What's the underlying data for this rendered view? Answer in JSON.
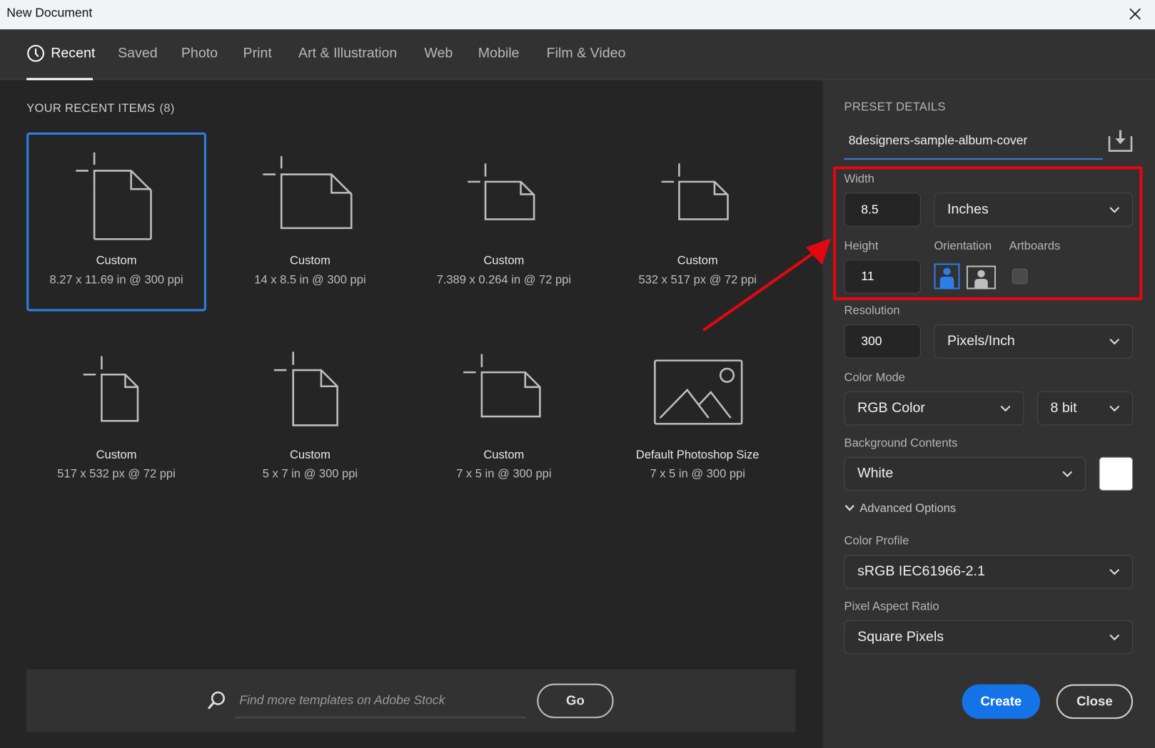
{
  "window": {
    "title": "New Document"
  },
  "tabs": [
    {
      "label": "Recent",
      "active": true
    },
    {
      "label": "Saved"
    },
    {
      "label": "Photo"
    },
    {
      "label": "Print"
    },
    {
      "label": "Art & Illustration"
    },
    {
      "label": "Web"
    },
    {
      "label": "Mobile"
    },
    {
      "label": "Film & Video"
    }
  ],
  "recent": {
    "title": "YOUR RECENT ITEMS",
    "count": "(8)",
    "items": [
      {
        "name": "Custom",
        "spec": "8.27 x 11.69 in @ 300 ppi",
        "icon": "portrait-doc-icon",
        "selected": true
      },
      {
        "name": "Custom",
        "spec": "14 x 8.5 in @ 300 ppi",
        "icon": "landscape-doc-icon"
      },
      {
        "name": "Custom",
        "spec": "7.389 x 0.264 in @ 72 ppi",
        "icon": "landscape-doc-icon"
      },
      {
        "name": "Custom",
        "spec": "532 x 517 px @ 72 ppi",
        "icon": "landscape-doc-icon"
      },
      {
        "name": "Custom",
        "spec": "517 x 532 px @ 72 ppi",
        "icon": "portrait-doc-icon"
      },
      {
        "name": "Custom",
        "spec": "5 x 7 in @ 300 ppi",
        "icon": "portrait-doc-icon"
      },
      {
        "name": "Custom",
        "spec": "7 x 5 in @ 300 ppi",
        "icon": "landscape-doc-icon"
      },
      {
        "name": "Default Photoshop Size",
        "spec": "7 x 5 in @ 300 ppi",
        "icon": "image-icon"
      }
    ]
  },
  "stock": {
    "placeholder": "Find more templates on Adobe Stock",
    "go_label": "Go"
  },
  "preset": {
    "title": "PRESET DETAILS",
    "name": "8designers-sample-album-cover",
    "width_label": "Width",
    "width_value": "8.5",
    "width_unit": "Inches",
    "height_label": "Height",
    "height_value": "11",
    "orientation_label": "Orientation",
    "orientation_selected": "portrait",
    "artboards_label": "Artboards",
    "artboards_checked": false,
    "resolution_label": "Resolution",
    "resolution_value": "300",
    "resolution_unit": "Pixels/Inch",
    "color_mode_label": "Color Mode",
    "color_mode": "RGB Color",
    "bit_depth": "8 bit",
    "background_label": "Background Contents",
    "background": "White",
    "background_swatch": "#ffffff",
    "advanced_label": "Advanced Options",
    "color_profile_label": "Color Profile",
    "color_profile": "sRGB IEC61966-2.1",
    "pixel_aspect_label": "Pixel Aspect Ratio",
    "pixel_aspect": "Square Pixels"
  },
  "actions": {
    "create_label": "Create",
    "close_label": "Close"
  },
  "colors": {
    "accent": "#1473e6",
    "selection": "#2d7ee6",
    "annotation": "#e3080f"
  }
}
